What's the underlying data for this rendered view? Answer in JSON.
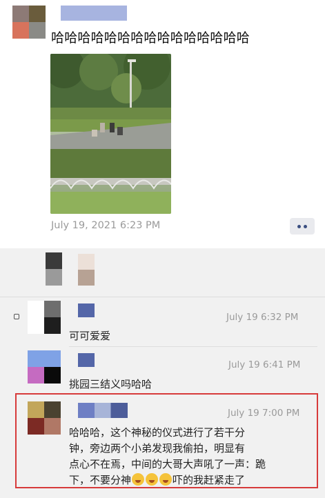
{
  "post": {
    "text": "哈哈哈哈哈哈哈哈哈哈哈哈哈哈哈",
    "timestamp": "July 19, 2021 6:23 PM",
    "photo_alt": ""
  },
  "likes": {},
  "comments": [
    {
      "text": "可可爱爱",
      "time": "July 19 6:32 PM"
    },
    {
      "text": "挑园三结义吗哈哈",
      "time": "July 19 6:41 PM"
    },
    {
      "lines": [
        "哈哈哈，这个神秘的仪式进行了若干分",
        "钟，旁边两个小弟发现我偷拍，明显有",
        "点心不在焉，中间的大哥大声吼了一声：跪"
      ],
      "last_prefix": "下，不要分神",
      "last_suffix": "吓的我赶紧走了",
      "time": "July 19 7:00 PM"
    }
  ],
  "icons": {
    "more": "more-dots-icon",
    "emoji": "laughing-tears-emoji"
  },
  "colors": {
    "highlight_border": "#d73a3a",
    "timestamp": "#9a9a9a",
    "feed_bg": "#f1f1f1"
  }
}
